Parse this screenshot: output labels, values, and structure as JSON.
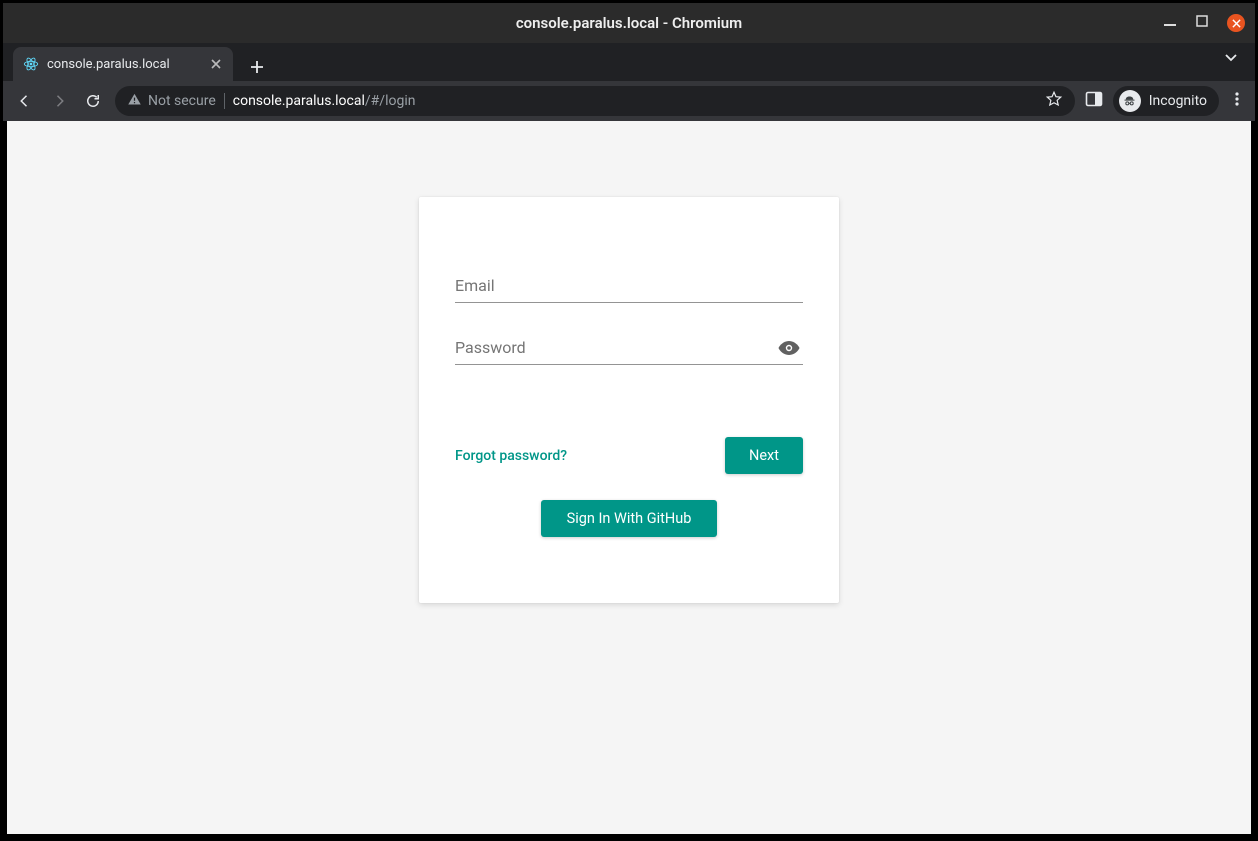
{
  "window": {
    "title": "console.paralus.local - Chromium"
  },
  "tab": {
    "title": "console.paralus.local"
  },
  "addressbar": {
    "security": "Not secure",
    "host": "console.paralus.local",
    "path": "/#/login"
  },
  "incognito": {
    "label": "Incognito"
  },
  "login": {
    "email_label": "Email",
    "password_label": "Password",
    "forgot": "Forgot password?",
    "next": "Next",
    "github": "Sign In With GitHub"
  },
  "colors": {
    "accent": "#009688"
  }
}
